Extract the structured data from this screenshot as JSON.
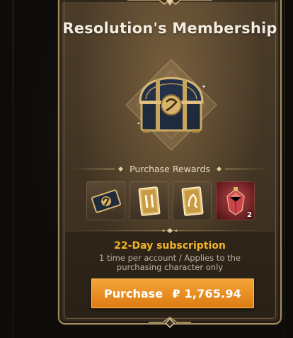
{
  "membership": {
    "title": "Resolution's Membership",
    "chest_icon": "treasure-chest-icon"
  },
  "rewards": {
    "header": "Purchase Rewards",
    "items": [
      {
        "name": "membership-card-icon",
        "count": ""
      },
      {
        "name": "gold-card-number-icon",
        "count": ""
      },
      {
        "name": "gold-card-creature-icon",
        "count": ""
      },
      {
        "name": "ruby-crystal-icon",
        "count": "2"
      }
    ]
  },
  "subscription": {
    "title": "22-Day subscription",
    "description": "1 time per account / Applies to the purchasing character only"
  },
  "purchase": {
    "label": "Purchase",
    "price": "₽ 1,765.94"
  },
  "colors": {
    "accent": "#f1b52a",
    "button": "#e88d22",
    "frame": "#a08a5e"
  }
}
